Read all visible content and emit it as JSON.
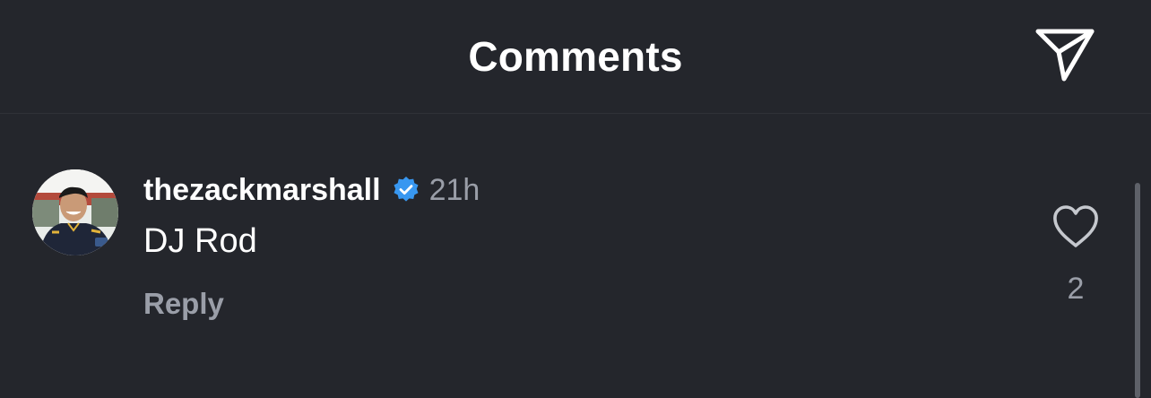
{
  "header": {
    "title": "Comments",
    "share_icon": "paper-plane-icon"
  },
  "comment": {
    "username": "thezackmarshall",
    "verified": true,
    "verified_color": "#3897f0",
    "timestamp": "21h",
    "text": "DJ Rod",
    "reply_label": "Reply",
    "like_icon": "heart-outline-icon",
    "like_count": "2"
  },
  "colors": {
    "background": "#24262c",
    "primary_text": "#ffffff",
    "secondary_text": "#9a9ea8"
  }
}
